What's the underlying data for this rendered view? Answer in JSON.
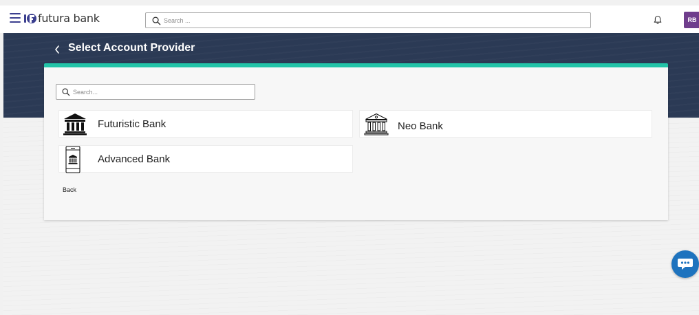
{
  "header": {
    "brand_name": "futura bank",
    "search_placeholder": "Search ...",
    "avatar_initials": "RB"
  },
  "page": {
    "title": "Select Account Provider"
  },
  "providers_panel": {
    "search_placeholder": "Search...",
    "providers": [
      {
        "label": "Futuristic Bank",
        "icon": "bank-building-solid-icon"
      },
      {
        "label": "Neo Bank",
        "icon": "bank-building-outline-icon"
      },
      {
        "label": "Advanced Bank",
        "icon": "mobile-bank-icon"
      }
    ],
    "back_label": "Back"
  },
  "colors": {
    "banner": "#2b3a55",
    "accent": "#22c4a8",
    "avatar": "#6f3d8c",
    "chat": "#1e73be"
  }
}
